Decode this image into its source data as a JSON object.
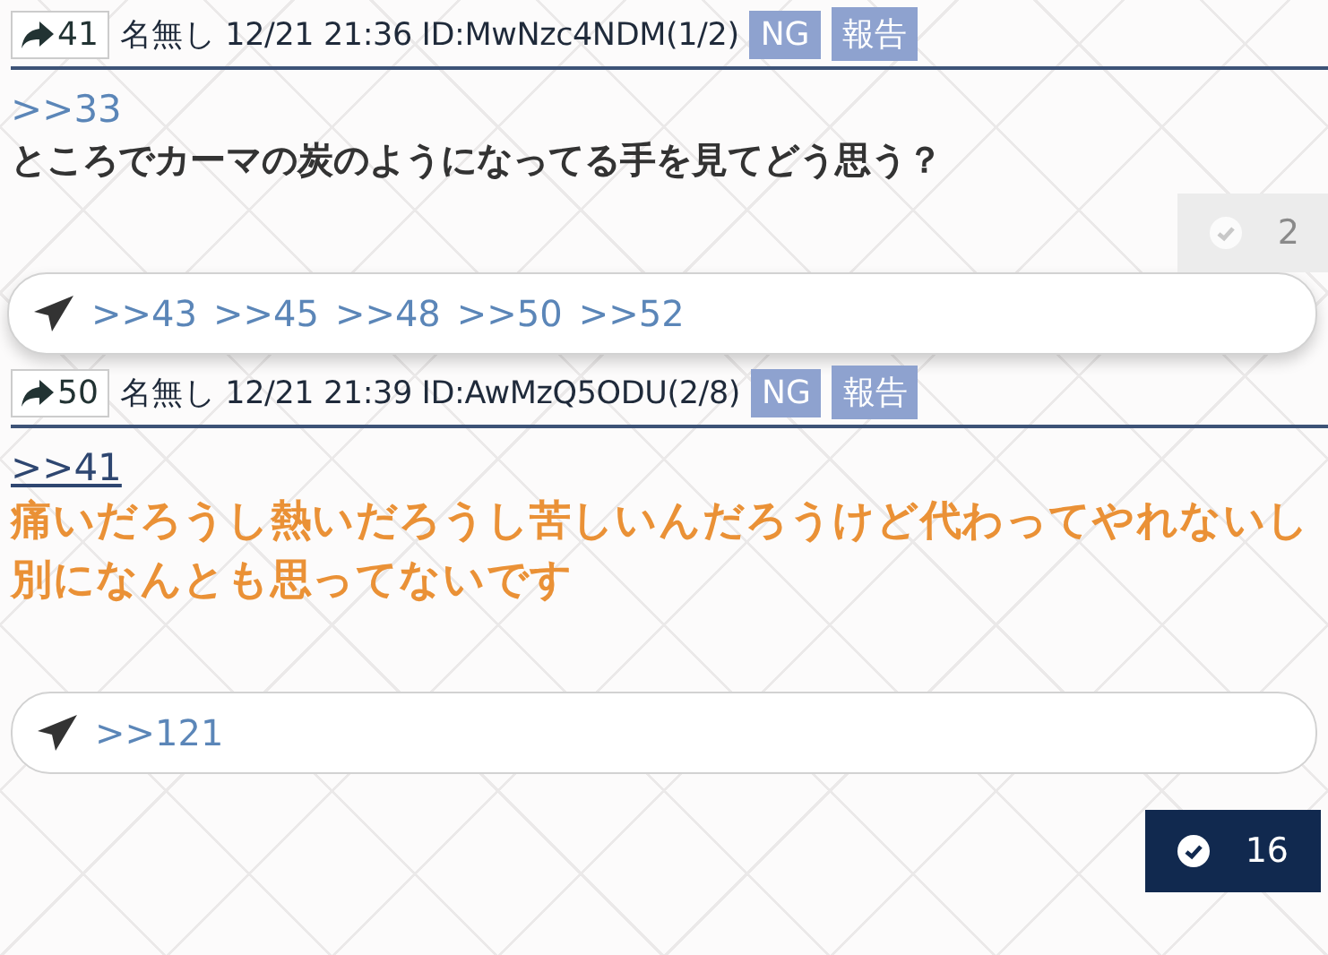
{
  "posts": [
    {
      "number": "41",
      "name": "名無し",
      "date": "12/21 21:36",
      "id": "ID:MwNzc4NDM(1/2)",
      "ng": "NG",
      "report": "報告",
      "anchor": ">>33",
      "anchor_visited": false,
      "body": [
        "ところでカーマの炭のようになってる手を見てどう思う？"
      ],
      "highlighted": false,
      "likes": {
        "count": "2",
        "liked": false
      },
      "replies": [
        ">>43",
        ">>45",
        ">>48",
        ">>50",
        ">>52"
      ],
      "reply_popup": true
    },
    {
      "number": "50",
      "name": "名無し",
      "date": "12/21 21:39",
      "id": "ID:AwMzQ5ODU(2/8)",
      "ng": "NG",
      "report": "報告",
      "anchor": ">>41",
      "anchor_visited": true,
      "body": [
        "痛いだろうし熱いだろうし苦しいんだろうけど代わってやれないし",
        "別になんとも思ってないです"
      ],
      "highlighted": true,
      "likes": {
        "count": "16",
        "liked": true
      },
      "replies": [
        ">>121"
      ],
      "reply_popup": false
    }
  ]
}
